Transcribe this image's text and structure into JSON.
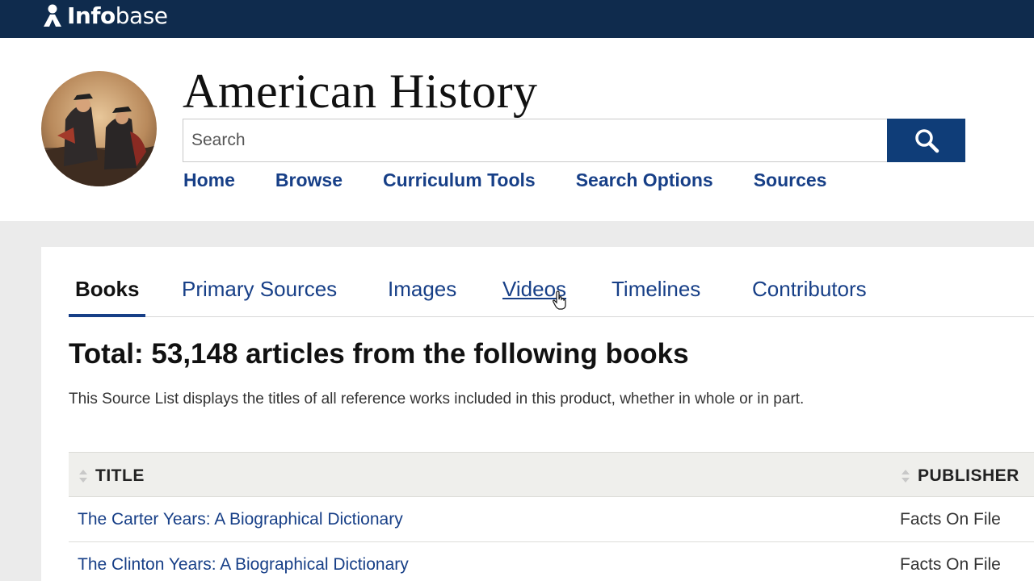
{
  "brand": {
    "name_bold": "Info",
    "name_rest": "base",
    "icon": "person-icon"
  },
  "site": {
    "title": "American History"
  },
  "search": {
    "placeholder": "Search",
    "button_icon": "search-icon"
  },
  "nav": [
    "Home",
    "Browse",
    "Curriculum Tools",
    "Search Options",
    "Sources"
  ],
  "tabs": [
    "Books",
    "Primary Sources",
    "Images",
    "Videos",
    "Timelines",
    "Contributors"
  ],
  "active_tab": "Books",
  "content": {
    "total": "Total: 53,148 articles from the following books",
    "description": "This Source List displays the titles of all reference works included in this product, whether in whole or in part."
  },
  "table": {
    "columns": [
      "TITLE",
      "PUBLISHER"
    ],
    "rows": [
      {
        "title": "The Carter Years: A Biographical Dictionary",
        "publisher": "Facts On File"
      },
      {
        "title": "The Clinton Years: A Biographical Dictionary",
        "publisher": "Facts On File"
      }
    ]
  },
  "colors": {
    "topbar": "#0f2b4d",
    "accent": "#0f3d78",
    "link": "#173f87"
  }
}
